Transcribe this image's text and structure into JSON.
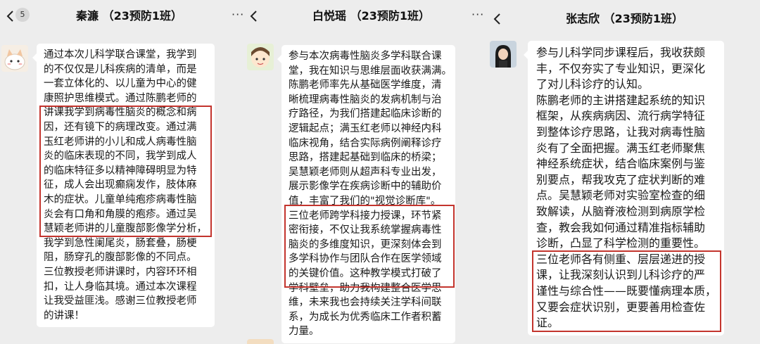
{
  "panels": [
    {
      "title": "秦濂 （23预防1班）",
      "unread_badge": "5",
      "back_icon": "chevron-left-icon",
      "more_icon": "more-dots-icon",
      "message_lines": [
        "通过本次儿科学联合课堂，我学到",
        "的不仅仅是儿科疾病的清单，而是",
        "一套立体化的、以儿童为中心的健",
        "康照护思维模式。通过陈鹏老师的",
        "讲课我学到病毒性脑炎的概念和病",
        "因，还有镜下的病理改变。通过满",
        "玉红老师讲的小儿和成人病毒性脑",
        "炎的临床表现的不同，我学到成人",
        "的临床特征多以精神障碍明显为特",
        "征，成人会出现癫痫发作，肢体麻",
        "木的症状。儿童单纯疱疹病毒性脑",
        "炎会有口角和角膜的疱疹。通过吴",
        "慧颖老师讲的儿童腹部影像学分析，",
        "我学到急性阑尾炎，肠套叠，肠梗",
        "阻，肠穿孔的腹部影像的不同点。",
        "三位教授老师讲课时，内容环环相",
        "扣，让人身临其境。通过本次课程",
        "让我受益匪浅。感谢三位教授老师",
        "的讲课！"
      ]
    },
    {
      "title": "白悦瑶 （23预防1班）",
      "back_icon": "chevron-left-icon",
      "more_icon": "more-dots-icon",
      "message_lines": [
        "参与本次病毒性脑炎多学科联合课",
        "堂，我在知识与思维层面收获满满。",
        "陈鹏老师率先从基础医学维度，清",
        "晰梳理病毒性脑炎的发病机制与治",
        "疗路径，为我们搭建起临床诊断的",
        "逻辑起点；满玉红老师以神经内科",
        "临床视角，结合实际病例阐释诊疗",
        "思路，搭建起基础到临床的桥梁；",
        "吴慧颖老师则从超声科专业出发，",
        "展示影像学在疾病诊断中的辅助价",
        "值，丰富了我们的\"视觉诊断库\"。",
        "三位老师跨学科接力授课，环节紧",
        "密衔接，不仅让我系统掌握病毒性",
        "脑炎的多维度知识，更深刻体会到",
        "多学科协作与团队合作在医学领域",
        "的关键价值。这种教学模式打破了",
        "学科壁垒，助力我构建整合医学思",
        "维，未来我也会持续关注学科间联",
        "系，为成长为优秀临床工作者积蓄",
        "力量。"
      ]
    },
    {
      "title": "张志欣 （23预防1班）",
      "back_icon": "chevron-left-icon",
      "more_icon": "more-dots-icon",
      "message_lines": [
        "参与儿科学同步课程后，我收获颇",
        "丰，不仅夯实了专业知识，更深化",
        "了对儿科诊疗的认知。",
        "陈鹏老师的主讲搭建起系统的知识",
        "框架，从疾病病因、流行病学特征",
        "到整体诊疗思路，让我对病毒性脑",
        "炎有了全面把握。满玉红老师聚焦",
        "神经系统症状，结合临床案例与鉴",
        "别要点，帮我攻克了症状判断的难",
        "点。吴慧颖老师对实验室检查的细",
        "致解读，从脑脊液检测到病原学检",
        "查，教会我如何通过精准指标辅助",
        "诊断，凸显了科学检测的重要性。",
        "三位老师各有侧重、层层递进的授",
        "课，让我深刻认识到儿科诊疗的严",
        "谨性与综合性——既要懂病理本质，",
        "又要会症状识别，更要善用检查佐",
        "证。"
      ]
    }
  ],
  "colors": {
    "background": "#ededed",
    "bubble": "#ffffff",
    "highlight_box": "#c3342d"
  }
}
